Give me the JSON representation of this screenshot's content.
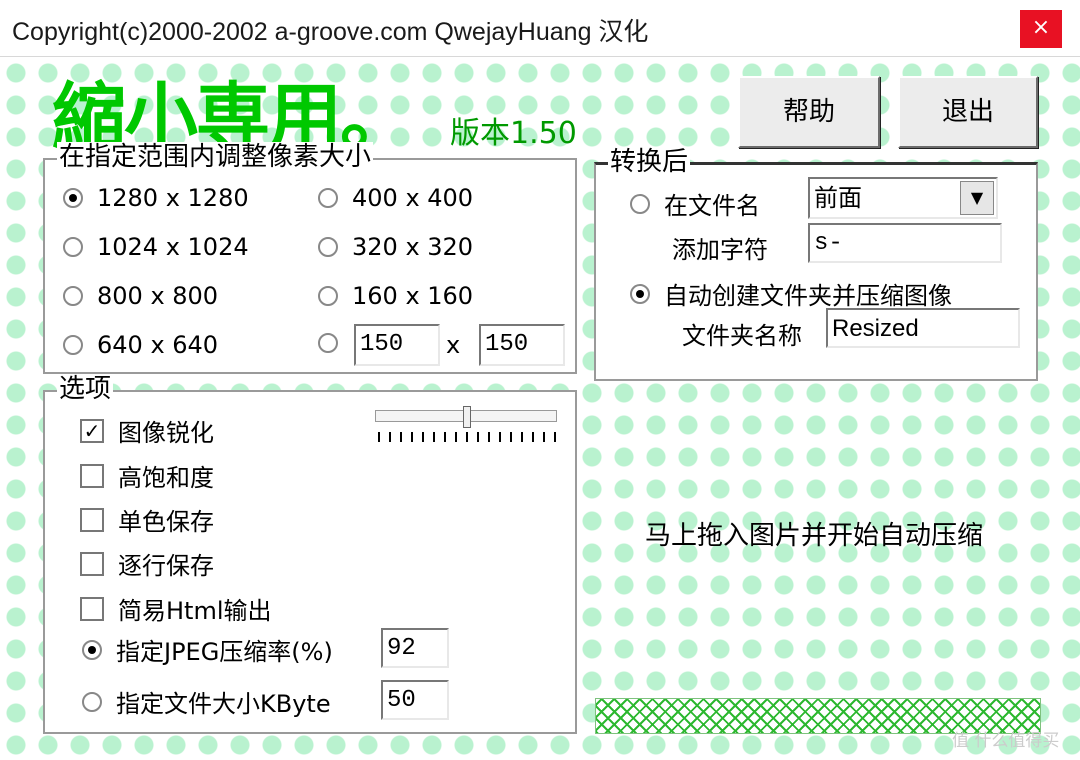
{
  "window": {
    "title": "Copyright(c)2000-2002 a-groove.com QwejayHuang 汉化",
    "close_glyph": "×"
  },
  "app": {
    "logo": "縮小専用。",
    "version": "版本1.50",
    "help_label": "帮助",
    "exit_label": "退出"
  },
  "size_group": {
    "title": "在指定范围内调整像素大小",
    "options": [
      {
        "label": "1280 x 1280",
        "selected": true
      },
      {
        "label": "1024 x 1024",
        "selected": false
      },
      {
        "label": "800 x 800",
        "selected": false
      },
      {
        "label": "640 x 640",
        "selected": false
      },
      {
        "label": "400 x 400",
        "selected": false
      },
      {
        "label": "320 x 320",
        "selected": false
      },
      {
        "label": "160 x 160",
        "selected": false
      }
    ],
    "custom": {
      "width": "150",
      "separator": "x",
      "height": "150",
      "selected": false
    }
  },
  "convert_group": {
    "title": "转换后",
    "filename_label": "在文件名",
    "position_value": "前面",
    "add_char_label": "添加字符",
    "add_char_value": "s-",
    "auto_folder_label": "自动创建文件夹并压缩图像",
    "folder_name_label": "文件夹名称",
    "folder_name_value": "Resized",
    "selected": "auto_folder"
  },
  "options_group": {
    "title": "选项",
    "sharpen": {
      "label": "图像锐化",
      "checked": true
    },
    "saturation": {
      "label": "高饱和度",
      "checked": false
    },
    "mono": {
      "label": "单色保存",
      "checked": false
    },
    "progressive": {
      "label": "逐行保存",
      "checked": false
    },
    "html": {
      "label": "简易Html输出",
      "checked": false
    },
    "jpeg_quality": {
      "label": "指定JPEG压缩率(%)",
      "value": "92",
      "selected": true
    },
    "file_size": {
      "label": "指定文件大小KByte",
      "value": "50",
      "selected": false
    },
    "sharpen_level": 0.5
  },
  "drop_hint": "马上拖入图片并开始自动压缩",
  "watermark": "值 什么值得买"
}
